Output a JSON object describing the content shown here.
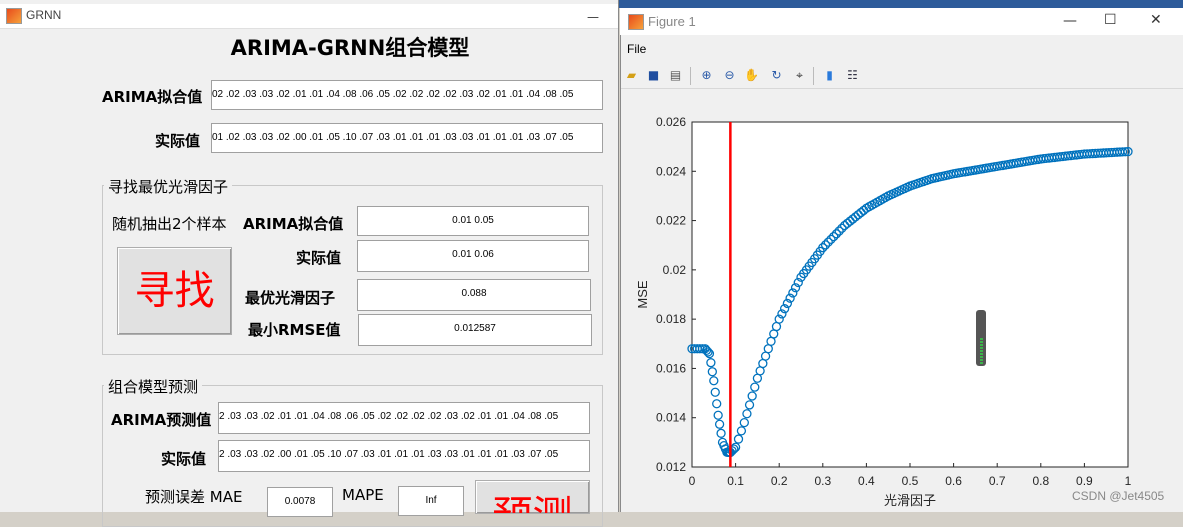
{
  "grnn_window": {
    "title": "GRNN",
    "minimize": "—",
    "main_title": "ARIMA-GRNN组合模型",
    "fit_label": "ARIMA拟合值",
    "fit_value": "02 .02 .03 .03 .02 .01 .01 .04 .08 .06 .05 .02 .02 .02 .02 .03 .02 .01 .01 .04 .08 .05",
    "actual_label": "实际值",
    "actual_value": "01 .02 .03 .03 .02 .00 .01 .05 .10 .07 .03 .01 .01 .01 .03 .03 .01 .01 .01 .03 .07 .05",
    "search_group": {
      "title": "寻找最优光滑因子",
      "sample_text": "随机抽出2个样本",
      "fit_label": "ARIMA拟合值",
      "fit_value": "0.01        0.05",
      "actual_label": "实际值",
      "actual_value": "0.01        0.06",
      "best_factor_label": "最优光滑因子",
      "best_factor_value": "0.088",
      "min_rmse_label": "最小RMSE值",
      "min_rmse_value": "0.012587",
      "find_button": "寻找"
    },
    "predict_group": {
      "title": "组合模型预测",
      "pred_label": "ARIMA预测值",
      "pred_value": "2 .03 .03 .02 .01 .01 .04 .08 .06 .05 .02 .02 .02 .02 .03 .02 .01 .01 .04 .08 .05",
      "actual_label": "实际值",
      "actual_value": "2 .03 .03 .02 .00 .01 .05 .10 .07 .03 .01 .01 .01 .03 .03 .01 .01 .01 .03 .07 .05",
      "err_label": "预测误差 MAE",
      "mae_value": "0.0078",
      "mape_label": "MAPE",
      "mape_value": "Inf",
      "predict_button": "预测"
    }
  },
  "figure_window": {
    "title": "Figure 1",
    "minimize": "—",
    "maximize": "☐",
    "close": "✕",
    "menu_file": "File",
    "toolbar_icons": [
      "new-figure-icon",
      "open-icon",
      "save-icon",
      "print-icon",
      "zoom-in-icon",
      "zoom-out-icon",
      "pan-icon",
      "rotate-icon",
      "data-cursor-icon",
      "colorbar-icon",
      "legend-icon"
    ]
  },
  "watermark": "CSDN @Jet4505",
  "colors": {
    "marker": "#0072bd",
    "vline": "#ff0000",
    "find_text": "#ff0000"
  },
  "chart_data": {
    "type": "scatter",
    "xlabel": "光滑因子",
    "ylabel": "MSE",
    "xlim": [
      0,
      1
    ],
    "ylim": [
      0.012,
      0.026
    ],
    "xticks": [
      "0",
      "0.1",
      "0.2",
      "0.3",
      "0.4",
      "0.5",
      "0.6",
      "0.7",
      "0.8",
      "0.9",
      "1"
    ],
    "yticks": [
      "0.012",
      "0.014",
      "0.016",
      "0.018",
      "0.02",
      "0.022",
      "0.024",
      "0.026"
    ],
    "vline_x": 0.088,
    "grid": false,
    "curve_points": [
      [
        0.0,
        0.0168
      ],
      [
        0.03,
        0.0168
      ],
      [
        0.04,
        0.0166
      ],
      [
        0.05,
        0.0155
      ],
      [
        0.06,
        0.0141
      ],
      [
        0.07,
        0.013
      ],
      [
        0.08,
        0.0126
      ],
      [
        0.088,
        0.01259
      ],
      [
        0.1,
        0.0128
      ],
      [
        0.12,
        0.0138
      ],
      [
        0.15,
        0.0156
      ],
      [
        0.2,
        0.018
      ],
      [
        0.25,
        0.0197
      ],
      [
        0.3,
        0.0209
      ],
      [
        0.35,
        0.0218
      ],
      [
        0.4,
        0.0225
      ],
      [
        0.45,
        0.023
      ],
      [
        0.5,
        0.0234
      ],
      [
        0.55,
        0.0237
      ],
      [
        0.6,
        0.0239
      ],
      [
        0.7,
        0.0242
      ],
      [
        0.8,
        0.0245
      ],
      [
        0.9,
        0.0247
      ],
      [
        1.0,
        0.0248
      ]
    ]
  }
}
